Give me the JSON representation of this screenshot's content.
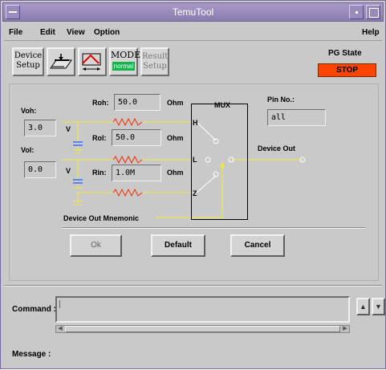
{
  "window": {
    "title": "TemuTool"
  },
  "menubar": {
    "file": "File",
    "edit": "Edit",
    "view": "View",
    "option": "Option",
    "help": "Help"
  },
  "toolbar": {
    "device_setup_line1": "Device",
    "device_setup_line2": "Setup",
    "mode_label": "MODE",
    "mode_value": "normal",
    "result_line1": "Result",
    "result_line2": "Setup"
  },
  "pg_state": {
    "label": "PG State",
    "value": "STOP"
  },
  "panel": {
    "voh_label": "Voh:",
    "voh_value": "3.0",
    "voh_unit": "V",
    "vol_label": "Vol:",
    "vol_value": "0.0",
    "vol_unit": "V",
    "roh_label": "Roh:",
    "roh_value": "50.0",
    "roh_unit": "Ohm",
    "rol_label": "Rol:",
    "rol_value": "50.0",
    "rol_unit": "Ohm",
    "rin_label": "Rin:",
    "rin_value": "1.0M",
    "rin_unit": "Ohm",
    "mux_label": "MUX",
    "pin_h": "H",
    "pin_l": "L",
    "pin_z": "Z",
    "pin_no_label": "Pin No.:",
    "pin_no_value": "all",
    "device_out_label": "Device Out",
    "device_out_mnemonic_label": "Device Out Mnemonic"
  },
  "buttons": {
    "ok": "Ok",
    "default": "Default",
    "cancel": "Cancel"
  },
  "command": {
    "label": "Command :",
    "value": ""
  },
  "message": {
    "label": "Message :"
  },
  "colors": {
    "wire": "#f2ea3a",
    "resistor": "#ff2a00",
    "capacitor": "#3a6cff",
    "pg_state_bg": "#ff4400",
    "mode_badge": "#17b34d"
  }
}
